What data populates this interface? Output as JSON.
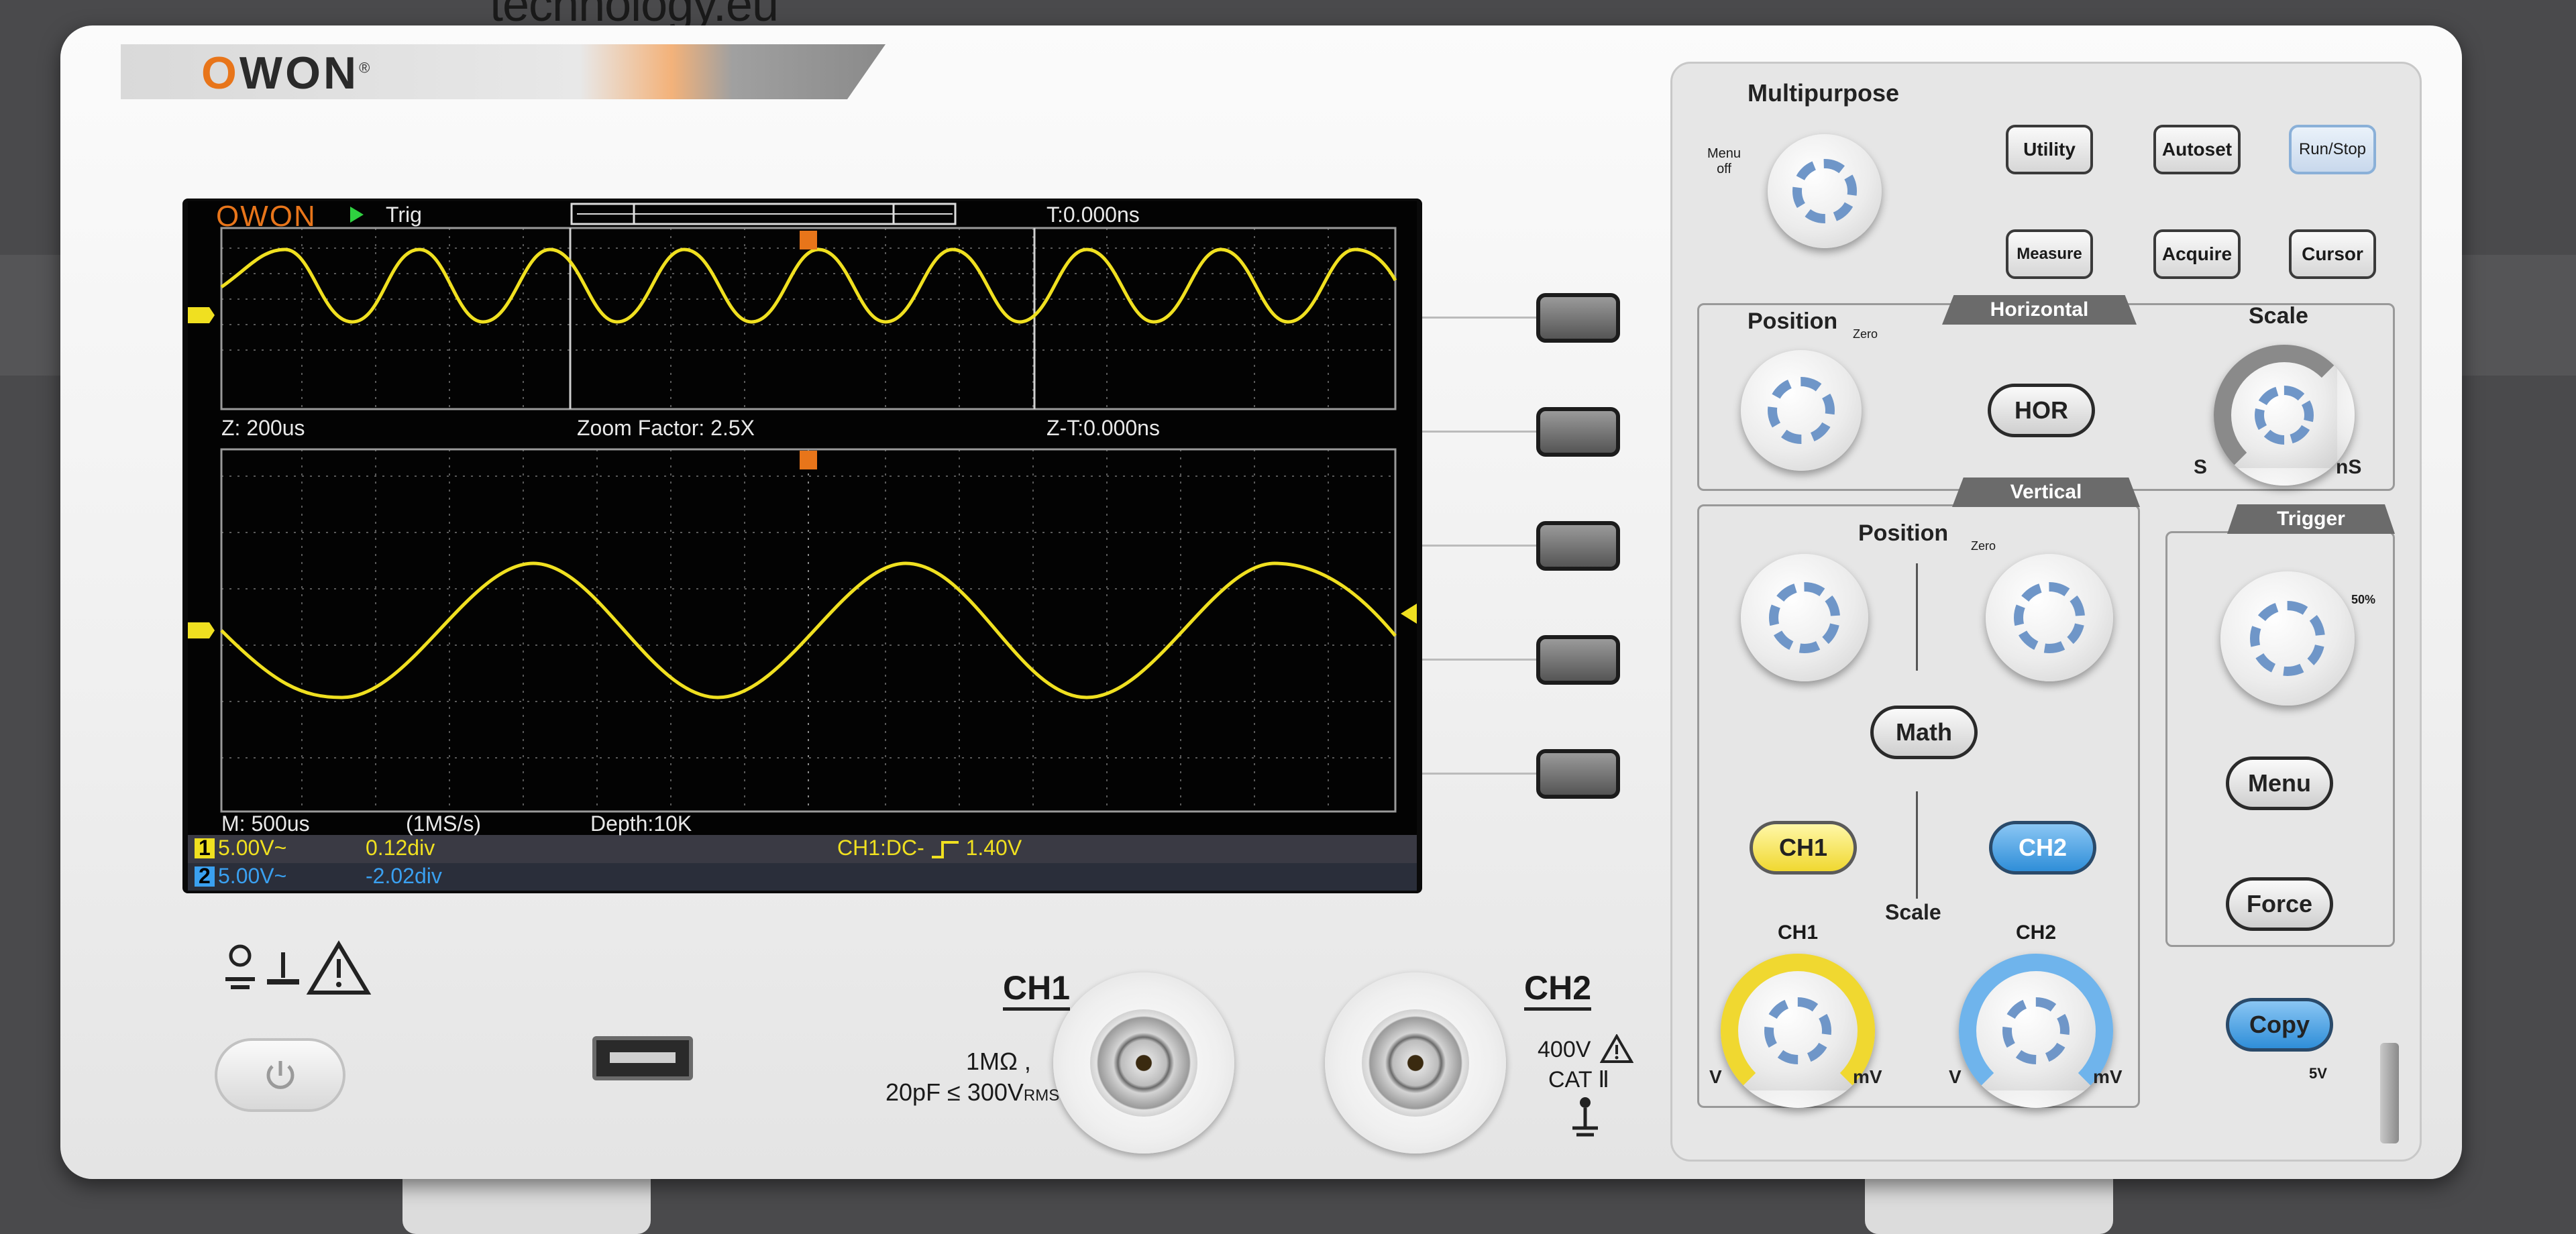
{
  "watermark": "technology.eu",
  "brand": {
    "name_o": "O",
    "name_won": "WON",
    "reg": "®"
  },
  "screen": {
    "brand": "OWON",
    "run_state": "Trig",
    "trigger_time": "T:0.000ns",
    "zoom_timebase": "Z: 200us",
    "zoom_factor": "Zoom Factor: 2.5X",
    "zoom_trigger_time": "Z-T:0.000ns",
    "main_timebase": "M: 500us",
    "sample_rate": "(1MS/s)",
    "depth": "Depth:10K",
    "ch1_num": "1",
    "ch1_scale": "5.00V~",
    "ch1_offset": "0.12div",
    "ch2_num": "2",
    "ch2_scale": "5.00V~",
    "ch2_offset": "-2.02div",
    "trigger_info": "CH1:DC-",
    "trigger_level": "1.40V",
    "marker_t": "T",
    "marker_1": "1",
    "colors": {
      "ch1": "#f0e020",
      "ch2": "#3aa0f0",
      "run": "#2fd040",
      "brand": "#e8751a"
    }
  },
  "panel": {
    "multipurpose": "Multipurpose",
    "menu_off": "Menu off",
    "utility": "Utility",
    "autoset": "Autoset",
    "run_stop": "Run/Stop",
    "measure": "Measure",
    "acquire": "Acquire",
    "cursor": "Cursor",
    "horizontal": "Horizontal",
    "h_position": "Position",
    "zero": "Zero",
    "h_scale": "Scale",
    "hor": "HOR",
    "s": "S",
    "ns": "nS",
    "vertical": "Vertical",
    "v_position": "Position",
    "math": "Math",
    "ch1": "CH1",
    "ch2": "CH2",
    "v_scale": "Scale",
    "ch1_knob": "CH1",
    "ch2_knob": "CH2",
    "v": "V",
    "mv": "mV",
    "trigger": "Trigger",
    "fifty": "50%",
    "menu": "Menu",
    "force": "Force",
    "copy": "Copy",
    "probe_5v": "5V"
  },
  "front": {
    "ch1": "CH1",
    "ch2": "CH2",
    "input_spec_1": "1MΩ ,",
    "input_spec_2": "20pF ≤ 300V",
    "rms": "RMS",
    "max_v": "400V",
    "cat": "CAT Ⅱ"
  }
}
